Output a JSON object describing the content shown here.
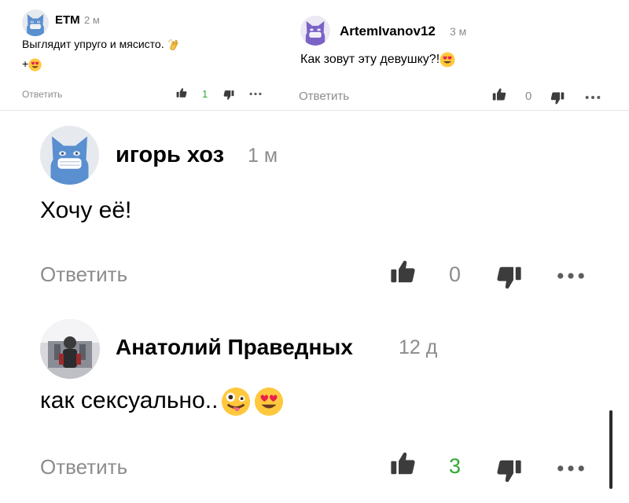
{
  "colors": {
    "muted": "#8c8c8c",
    "icon": "#3c3c3c",
    "positive": "#2eaa2e",
    "avatar_blue": "#5a8fd0",
    "avatar_purple": "#7b63c6"
  },
  "icons": {
    "avatar": "cat-mask-avatar",
    "like": "thumbs-up-icon",
    "dislike": "thumbs-down-icon",
    "more": "more-dots-icon",
    "emoji_clap": "clapping-hands-emoji",
    "emoji_love": "heart-eyes-emoji",
    "emoji_zany": "zany-face-emoji"
  },
  "comments": [
    {
      "author": "ETM",
      "time": "2 м",
      "text": "Выглядит упруго и мясисто.",
      "text_line2": "+",
      "reply": "Ответить",
      "likes": "1"
    },
    {
      "author": "ArtemIvanov12",
      "time": "3 м",
      "text": "Как зовут эту девушку?!",
      "reply": "Ответить",
      "likes": "0"
    },
    {
      "author": "игорь хоз",
      "time": "1 м",
      "text": "Хочу её!",
      "reply": "Ответить",
      "likes": "0"
    },
    {
      "author": "Анатолий Праведных",
      "time": "12 д",
      "text": "как сексуально..",
      "reply": "Ответить",
      "likes": "3"
    }
  ]
}
